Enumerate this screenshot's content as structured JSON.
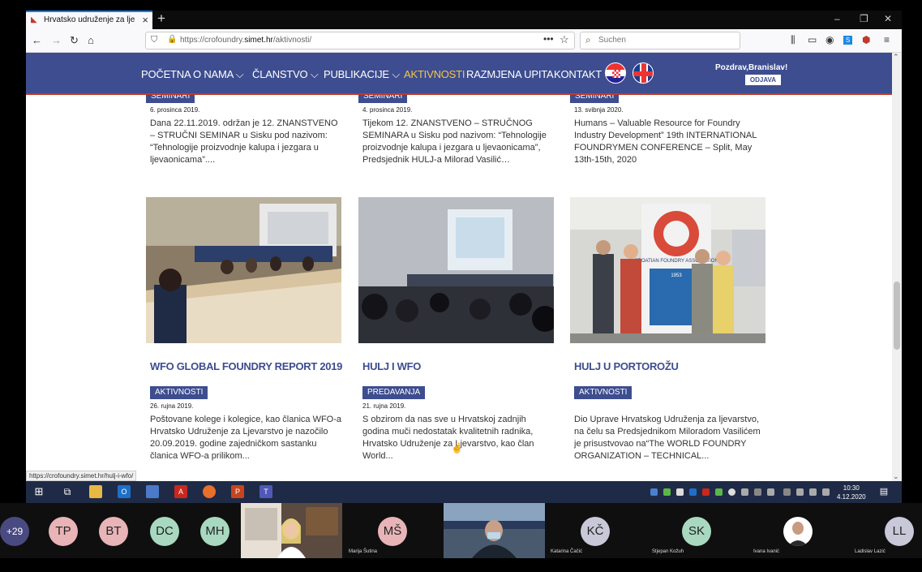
{
  "browser": {
    "tab_title": "Hrvatsko udruženje za ljevarstv",
    "url_prefix": "https://crofoundry.",
    "url_domain": "simet.hr",
    "url_path": "/aktivnosti/",
    "search_placeholder": "Suchen",
    "status_url": "https://crofoundry.simet.hr/hulj-i-wfo/"
  },
  "site": {
    "menu": [
      "POČETNA",
      "O NAMA",
      "ČLANSTVO",
      "PUBLIKACIJE",
      "AKTIVNOSTI",
      "RAZMJENA UPITA",
      "KONTAKT"
    ],
    "greeting": "Pozdrav,Branislav!",
    "logout": "ODJAVA"
  },
  "top_cards": [
    {
      "badge": "SEMINARI",
      "date": "6. prosinca 2019.",
      "excerpt": "Dana 22.11.2019. održan je 12. ZNANSTVENO – STRUČNI SEMINAR u Sisku pod nazivom: “Tehnologije proizvodnje kalupa i jezgara u ljevaonicama”...."
    },
    {
      "badge": "SEMINARI",
      "date": "4. prosinca 2019.",
      "excerpt": "Tijekom 12. ZNANSTVENO – STRUČNOG SEMINARA u Sisku pod nazivom: “Tehnologije proizvodnje kalupa i jezgara u ljevaonicama”, Predsjednik HULJ-a Milorad Vasilić…"
    },
    {
      "badge": "SEMINARI",
      "date": "13. svibnja 2020.",
      "excerpt": "Humans – Valuable Resource for Foundry Industry Development” 19th INTERNATIONAL FOUNDRYMEN CONFERENCE – Split, May 13th-15th, 2020"
    }
  ],
  "cards": [
    {
      "title": "WFO GLOBAL FOUNDRY REPORT 2019",
      "badge": "AKTIVNOSTI",
      "date": "26. rujna 2019.",
      "excerpt": "Poštovane kolege i kolegice, kao članica WFO-a Hrvatsko Udruženje za Ljevarstvo je nazočilo 20.09.2019. godine zajedničkom sastanku članica WFO-a prilikom..."
    },
    {
      "title": "HULJ I WFO",
      "badge": "PREDAVANJA",
      "date": "21. rujna 2019.",
      "excerpt": "S obzirom da nas sve u Hrvatskoj zadnjih godina muči nedostatak kvalitetnih radnika, Hrvatsko Udruženje za Ljevarstvo, kao član World..."
    },
    {
      "title": "HULJ U PORTOROŽU",
      "badge": "AKTIVNOSTI",
      "date": "",
      "excerpt": "Dio Uprave Hrvatskog Udruženja za ljevarstvo, na čelu sa Predsjednikom Miloradom Vasilićem je prisustvovao na“The WORLD FOUNDRY ORGANIZATION – TECHNICAL..."
    }
  ],
  "banner_text": "CROATIAN FOUNDRY ASSOCIATION",
  "banner_year": "1953",
  "clock": {
    "time": "10:30",
    "date": "4.12.2020"
  },
  "participants": {
    "more": "+29",
    "avatars": [
      {
        "initials": "TP",
        "color": "#e8b4b8"
      },
      {
        "initials": "BT",
        "color": "#e8b4b8"
      },
      {
        "initials": "DC",
        "color": "#a8d8c0"
      },
      {
        "initials": "MH",
        "color": "#a8d8c0"
      },
      {
        "initials": "MŠ",
        "color": "#e8b4b8",
        "name": "Marija Šutina"
      },
      {
        "initials": "KČ",
        "color": "#c8c8d8",
        "name": "Katarina Čačić"
      },
      {
        "initials": "SK",
        "color": "#a8d8c0",
        "name": "Stjepan Kožuh"
      },
      {
        "initials": "LL",
        "color": "#c8c8d8",
        "name": "Ladislav Lazić"
      }
    ],
    "ivana": "Ivana Ivanić"
  }
}
